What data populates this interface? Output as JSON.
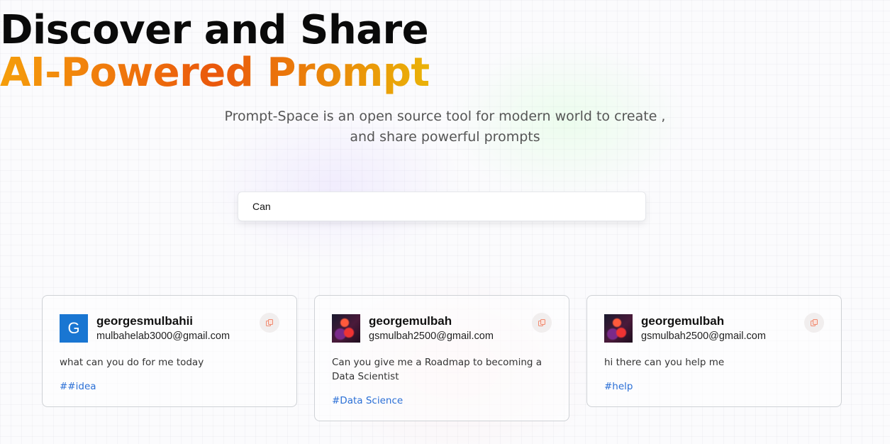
{
  "hero": {
    "title_line1": "Discover and Share",
    "title_line2": "AI-Powered Prompt",
    "description": "Prompt-Space is an open source tool for modern world to create , and share powerful prompts"
  },
  "search": {
    "value": "Can"
  },
  "colors": {
    "gradient_start": "#f59e0b",
    "gradient_mid": "#ea580c",
    "gradient_end": "#eab308",
    "tag": "#2a6fd6",
    "avatar_bg": "#1976d2"
  },
  "cards": [
    {
      "username": "georgesmulbahii",
      "email": "mulbahelab3000@gmail.com",
      "avatar_letter": "G",
      "prompt": "what can you do for me today",
      "tag": "##idea",
      "copy_icon": "copy-icon"
    },
    {
      "username": "georgemulbah",
      "email": "gsmulbah2500@gmail.com",
      "avatar_letter": "",
      "prompt": "Can you give me a Roadmap to becoming a Data Scientist",
      "tag": "#Data Science",
      "copy_icon": "copy-icon"
    },
    {
      "username": "georgemulbah",
      "email": "gsmulbah2500@gmail.com",
      "avatar_letter": "",
      "prompt": "hi there can you help me",
      "tag": "#help",
      "copy_icon": "copy-icon"
    }
  ]
}
